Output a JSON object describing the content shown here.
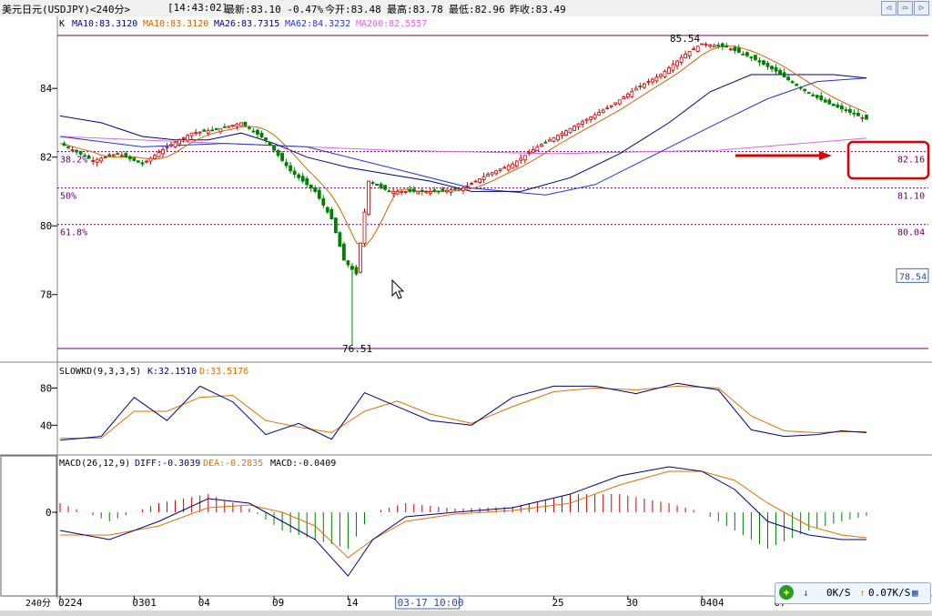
{
  "titlebar": {
    "symbol": "美元日元(USDJPY)<240分>",
    "time": "[14:43:02]",
    "latest": "最新:83.10 -0.47%",
    "open": "今开:83.48",
    "high": "最高:83.78",
    "low": "最低:82.96",
    "prev_close": "昨收:83.49"
  },
  "ma_legend": {
    "k": "K",
    "ma10a": "MA10:83.3120",
    "ma10b": "MA10:83.3120",
    "ma26": "MA26:83.7315",
    "ma62": "MA62:84.3232",
    "ma200": "MA200:82.5557"
  },
  "kdj_legend": {
    "name": "SLOWKD(9,3,3,5)",
    "k": "K:32.1510",
    "d": "D:33.5176"
  },
  "macd_legend": {
    "name": "MACD(26,12,9)",
    "diff": "DIFF:-0.3039",
    "dea": "DEA:-0.2835",
    "macd": "MACD:-0.0409"
  },
  "net": {
    "down": "0K/S",
    "up": "0.07K/S"
  },
  "period_label": "240分",
  "colors": {
    "up": "#cc0000",
    "down": "#008000",
    "ma10": "#cc6600",
    "ma26": "#000080",
    "ma62": "#2233dd",
    "ma200": "#dd66dd",
    "fib": "#660066",
    "k": "#000080",
    "d": "#e07000"
  },
  "chart_data": {
    "type": "candlestick",
    "ylim": [
      76.51,
      85.54
    ],
    "y_ticks": [
      "84",
      "82",
      "80",
      "78"
    ],
    "x_tick_labels": [
      "0224",
      "0301",
      "04",
      "09",
      "14",
      "17",
      "25",
      "30",
      "0404",
      "07"
    ],
    "cursor_label": "03-17 10:00",
    "high_label": "85.54",
    "low_label": "76.51",
    "fib_levels": [
      {
        "label": "38.2%",
        "value": 82.16
      },
      {
        "label": "50%",
        "value": 81.1
      },
      {
        "label": "61.8%",
        "value": 80.04
      }
    ],
    "fib_values": [
      "82.16",
      "81.10",
      "80.04"
    ],
    "price_box": "78.54",
    "price_path": [
      [
        0,
        82.4
      ],
      [
        8,
        81.9
      ],
      [
        14,
        82.1
      ],
      [
        20,
        81.8
      ],
      [
        26,
        82.3
      ],
      [
        32,
        82.7
      ],
      [
        38,
        82.8
      ],
      [
        44,
        83.0
      ],
      [
        50,
        82.5
      ],
      [
        56,
        81.6
      ],
      [
        62,
        81.0
      ],
      [
        66,
        80.2
      ],
      [
        69,
        79.0
      ],
      [
        72,
        78.6
      ],
      [
        75,
        81.3
      ],
      [
        80,
        81.0
      ],
      [
        86,
        81.0
      ],
      [
        92,
        81.0
      ],
      [
        98,
        81.1
      ],
      [
        104,
        81.5
      ],
      [
        110,
        81.8
      ],
      [
        116,
        82.3
      ],
      [
        122,
        82.7
      ],
      [
        128,
        83.1
      ],
      [
        134,
        83.5
      ],
      [
        140,
        84.0
      ],
      [
        146,
        84.4
      ],
      [
        152,
        85.0
      ],
      [
        156,
        85.3
      ],
      [
        162,
        85.2
      ],
      [
        168,
        84.9
      ],
      [
        174,
        84.5
      ],
      [
        180,
        84.0
      ],
      [
        186,
        83.6
      ],
      [
        192,
        83.3
      ],
      [
        196,
        83.1
      ]
    ],
    "ma26_path": [
      [
        0,
        83.2
      ],
      [
        10,
        83.0
      ],
      [
        20,
        82.6
      ],
      [
        28,
        82.5
      ],
      [
        36,
        82.5
      ],
      [
        44,
        82.7
      ],
      [
        52,
        82.4
      ],
      [
        60,
        82.0
      ],
      [
        70,
        81.7
      ],
      [
        80,
        81.5
      ],
      [
        90,
        81.3
      ],
      [
        100,
        81.0
      ],
      [
        112,
        81.0
      ],
      [
        124,
        81.4
      ],
      [
        136,
        82.1
      ],
      [
        148,
        83.0
      ],
      [
        158,
        83.9
      ],
      [
        168,
        84.4
      ],
      [
        178,
        84.4
      ],
      [
        188,
        84.4
      ],
      [
        196,
        84.3
      ]
    ],
    "ma62_path": [
      [
        0,
        82.6
      ],
      [
        20,
        82.3
      ],
      [
        40,
        82.4
      ],
      [
        60,
        82.3
      ],
      [
        80,
        81.7
      ],
      [
        100,
        81.1
      ],
      [
        118,
        80.9
      ],
      [
        130,
        81.2
      ],
      [
        145,
        82.1
      ],
      [
        160,
        83.0
      ],
      [
        172,
        83.7
      ],
      [
        184,
        84.2
      ],
      [
        196,
        84.3
      ]
    ],
    "ma200_path": [
      [
        0,
        82.6
      ],
      [
        40,
        82.4
      ],
      [
        80,
        82.2
      ],
      [
        120,
        82.1
      ],
      [
        160,
        82.2
      ],
      [
        196,
        82.55
      ]
    ],
    "slowkd": {
      "ylim": [
        10,
        100
      ],
      "y_ticks": [
        "80",
        "40"
      ],
      "k": [
        [
          0,
          24
        ],
        [
          10,
          28
        ],
        [
          18,
          70
        ],
        [
          26,
          45
        ],
        [
          34,
          82
        ],
        [
          42,
          65
        ],
        [
          50,
          30
        ],
        [
          58,
          42
        ],
        [
          66,
          25
        ],
        [
          74,
          75
        ],
        [
          82,
          60
        ],
        [
          90,
          45
        ],
        [
          100,
          40
        ],
        [
          110,
          70
        ],
        [
          120,
          82
        ],
        [
          130,
          82
        ],
        [
          140,
          74
        ],
        [
          150,
          85
        ],
        [
          160,
          78
        ],
        [
          168,
          35
        ],
        [
          176,
          28
        ],
        [
          184,
          30
        ],
        [
          190,
          34
        ],
        [
          196,
          32
        ]
      ],
      "d": [
        [
          0,
          26
        ],
        [
          10,
          26
        ],
        [
          18,
          55
        ],
        [
          26,
          55
        ],
        [
          34,
          70
        ],
        [
          42,
          72
        ],
        [
          50,
          45
        ],
        [
          58,
          38
        ],
        [
          66,
          32
        ],
        [
          74,
          55
        ],
        [
          82,
          66
        ],
        [
          90,
          52
        ],
        [
          100,
          42
        ],
        [
          110,
          60
        ],
        [
          120,
          76
        ],
        [
          130,
          80
        ],
        [
          140,
          78
        ],
        [
          150,
          82
        ],
        [
          160,
          80
        ],
        [
          168,
          50
        ],
        [
          176,
          34
        ],
        [
          184,
          32
        ],
        [
          190,
          33
        ],
        [
          196,
          33
        ]
      ]
    },
    "macd": {
      "ylim": [
        -0.9,
        0.55
      ],
      "y_ticks": [
        "0"
      ],
      "diff": [
        [
          0,
          -0.2
        ],
        [
          12,
          -0.3
        ],
        [
          24,
          -0.1
        ],
        [
          36,
          0.15
        ],
        [
          46,
          0.1
        ],
        [
          54,
          -0.1
        ],
        [
          62,
          -0.3
        ],
        [
          70,
          -0.7
        ],
        [
          76,
          -0.3
        ],
        [
          84,
          -0.05
        ],
        [
          96,
          0.0
        ],
        [
          110,
          0.05
        ],
        [
          124,
          0.2
        ],
        [
          136,
          0.4
        ],
        [
          148,
          0.5
        ],
        [
          156,
          0.45
        ],
        [
          164,
          0.25
        ],
        [
          172,
          -0.1
        ],
        [
          182,
          -0.25
        ],
        [
          190,
          -0.3
        ],
        [
          196,
          -0.3
        ]
      ],
      "dea": [
        [
          0,
          -0.25
        ],
        [
          12,
          -0.25
        ],
        [
          24,
          -0.15
        ],
        [
          36,
          0.05
        ],
        [
          46,
          0.08
        ],
        [
          54,
          0.0
        ],
        [
          62,
          -0.15
        ],
        [
          70,
          -0.5
        ],
        [
          76,
          -0.3
        ],
        [
          84,
          -0.1
        ],
        [
          96,
          -0.02
        ],
        [
          110,
          0.02
        ],
        [
          124,
          0.1
        ],
        [
          136,
          0.3
        ],
        [
          148,
          0.45
        ],
        [
          156,
          0.45
        ],
        [
          164,
          0.35
        ],
        [
          172,
          0.1
        ],
        [
          182,
          -0.15
        ],
        [
          190,
          -0.25
        ],
        [
          196,
          -0.28
        ]
      ]
    }
  }
}
